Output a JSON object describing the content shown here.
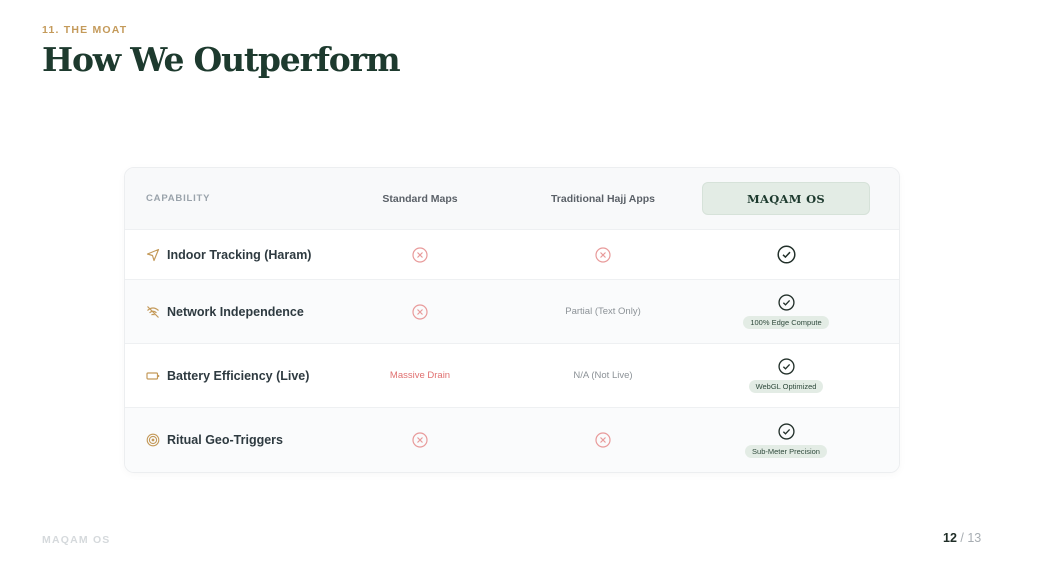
{
  "header": {
    "eyebrow": "11. THE MOAT",
    "title": "How We Outperform"
  },
  "table": {
    "columns": {
      "capability": "CAPABILITY",
      "standard_maps": "Standard Maps",
      "traditional_apps": "Traditional Hajj Apps",
      "maqam": "MAQAM OS"
    },
    "rows": [
      {
        "icon": "navigation-arrow-icon",
        "capability": "Indoor Tracking (Haram)",
        "standard": {
          "kind": "x"
        },
        "traditional": {
          "kind": "x"
        },
        "maqam": {
          "kind": "check",
          "note": ""
        }
      },
      {
        "icon": "wifi-off-icon",
        "capability": "Network Independence",
        "standard": {
          "kind": "x"
        },
        "traditional": {
          "kind": "text",
          "text": "Partial (Text Only)"
        },
        "maqam": {
          "kind": "check",
          "note": "100% Edge Compute"
        }
      },
      {
        "icon": "battery-icon",
        "capability": "Battery Efficiency (Live)",
        "standard": {
          "kind": "text",
          "text": "Massive Drain"
        },
        "traditional": {
          "kind": "text",
          "text": "N/A (Not Live)"
        },
        "maqam": {
          "kind": "check",
          "note": "WebGL Optimized"
        }
      },
      {
        "icon": "target-icon",
        "capability": "Ritual Geo-Triggers",
        "standard": {
          "kind": "x"
        },
        "traditional": {
          "kind": "x"
        },
        "maqam": {
          "kind": "check",
          "note": "Sub-Meter Precision"
        }
      }
    ]
  },
  "footer": {
    "brand": "MAQAM OS",
    "page_current": "12",
    "page_sep": " / ",
    "page_total": "13"
  },
  "colors": {
    "accent_gold": "#c49a5a",
    "title_green": "#1d3a2e",
    "negative_red": "#e07070",
    "pill_green": "#e3ece5"
  }
}
